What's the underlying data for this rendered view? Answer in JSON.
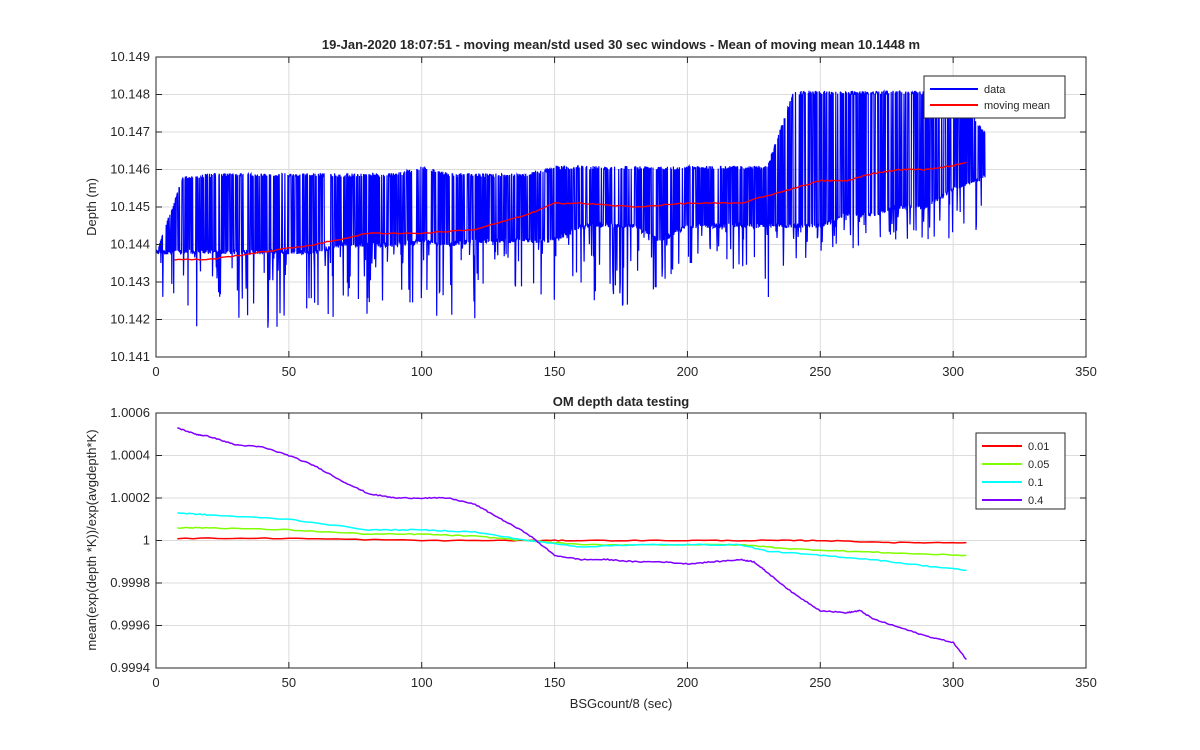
{
  "chart_data": [
    {
      "type": "line",
      "title": "19-Jan-2020 18:07:51 - moving mean/std used 30 sec windows - Mean of moving mean 10.1448 m",
      "xlabel": "",
      "ylabel": "Depth (m)",
      "xlim": [
        0,
        350
      ],
      "ylim": [
        10.141,
        10.149
      ],
      "xticks": [
        "0",
        "50",
        "100",
        "150",
        "200",
        "250",
        "300",
        "350"
      ],
      "yticks": [
        "10.141",
        "10.142",
        "10.143",
        "10.144",
        "10.145",
        "10.146",
        "10.147",
        "10.148",
        "10.149"
      ],
      "grid": true,
      "legend_position": "top-right",
      "series": [
        {
          "name": "data",
          "color": "#0000ff",
          "x": [
            0,
            10,
            20,
            30,
            40,
            50,
            60,
            70,
            80,
            90,
            100,
            110,
            120,
            130,
            140,
            150,
            160,
            170,
            180,
            190,
            200,
            210,
            220,
            230,
            240,
            250,
            260,
            270,
            280,
            290,
            300,
            312
          ],
          "low": [
            10.1415,
            10.1417,
            10.1418,
            10.1418,
            10.1418,
            10.1416,
            10.1418,
            10.1419,
            10.142,
            10.142,
            10.1422,
            10.142,
            10.1418,
            10.142,
            10.143,
            10.1421,
            10.1428,
            10.1422,
            10.1418,
            10.143,
            10.1435,
            10.1435,
            10.1432,
            10.1421,
            10.1435,
            10.1437,
            10.1438,
            10.1441,
            10.1441,
            10.1441,
            10.1441,
            10.1441
          ],
          "high": [
            10.1438,
            10.1458,
            10.1459,
            10.1459,
            10.1459,
            10.1459,
            10.1459,
            10.1459,
            10.1459,
            10.1459,
            10.1461,
            10.1459,
            10.1459,
            10.1459,
            10.1459,
            10.1461,
            10.1461,
            10.1461,
            10.1461,
            10.1461,
            10.1461,
            10.1461,
            10.1461,
            10.1461,
            10.1481,
            10.1481,
            10.1481,
            10.1481,
            10.1481,
            10.1481,
            10.1481,
            10.147
          ],
          "base": [
            10.1438,
            10.1438,
            10.1438,
            10.1438,
            10.1438,
            10.1438,
            10.1438,
            10.144,
            10.144,
            10.144,
            10.1441,
            10.144,
            10.1441,
            10.1441,
            10.1441,
            10.1441,
            10.1445,
            10.1445,
            10.1445,
            10.1441,
            10.1445,
            10.1445,
            10.1445,
            10.1445,
            10.1445,
            10.1445,
            10.1448,
            10.1448,
            10.145,
            10.145,
            10.1455,
            10.1458
          ]
        },
        {
          "name": "moving mean",
          "color": "#ff0000",
          "x": [
            7,
            20,
            40,
            60,
            80,
            100,
            120,
            140,
            150,
            160,
            180,
            200,
            220,
            240,
            250,
            260,
            270,
            280,
            290,
            300,
            305
          ],
          "y": [
            10.1436,
            10.1436,
            10.1438,
            10.144,
            10.1443,
            10.1443,
            10.1444,
            10.1448,
            10.1451,
            10.1451,
            10.145,
            10.1451,
            10.1451,
            10.1455,
            10.1457,
            10.1457,
            10.1459,
            10.146,
            10.146,
            10.1461,
            10.1462
          ]
        }
      ]
    },
    {
      "type": "line",
      "title": "OM depth data testing",
      "xlabel": "BSGcount/8 (sec)",
      "ylabel": "mean(exp(depth *K))/exp(avgdepth*K)",
      "xlim": [
        0,
        350
      ],
      "ylim": [
        0.9994,
        1.0006
      ],
      "xticks": [
        "0",
        "50",
        "100",
        "150",
        "200",
        "250",
        "300",
        "350"
      ],
      "yticks": [
        "0.9994",
        "0.9996",
        "0.9998",
        "1",
        "1.0002",
        "1.0004",
        "1.0006"
      ],
      "grid": true,
      "legend_position": "top-right",
      "series": [
        {
          "name": "0.01",
          "color": "#ff0000",
          "x": [
            8,
            50,
            100,
            140,
            160,
            200,
            230,
            250,
            280,
            305
          ],
          "y": [
            1.00001,
            1.00001,
            1.0,
            1.0,
            1.0,
            1.0,
            1.0,
            1.0,
            0.99999,
            0.99999
          ]
        },
        {
          "name": "0.05",
          "color": "#80ff00",
          "x": [
            8,
            20,
            50,
            80,
            100,
            120,
            140,
            160,
            190,
            220,
            240,
            260,
            280,
            305
          ],
          "y": [
            1.00006,
            1.00006,
            1.00005,
            1.00003,
            1.00003,
            1.00002,
            1.0,
            0.99998,
            0.99998,
            0.99998,
            0.99996,
            0.99995,
            0.99994,
            0.99993
          ]
        },
        {
          "name": "0.1",
          "color": "#00ffff",
          "x": [
            8,
            20,
            50,
            80,
            100,
            120,
            140,
            160,
            180,
            200,
            220,
            230,
            250,
            270,
            290,
            305
          ],
          "y": [
            1.00013,
            1.00012,
            1.0001,
            1.00005,
            1.00005,
            1.00004,
            1.0,
            0.99997,
            0.99998,
            0.99998,
            0.99998,
            0.99995,
            0.99993,
            0.99991,
            0.99988,
            0.99986
          ]
        },
        {
          "name": "0.4",
          "color": "#8000ff",
          "x": [
            8,
            15,
            20,
            30,
            40,
            50,
            60,
            70,
            80,
            90,
            100,
            110,
            120,
            130,
            140,
            150,
            160,
            170,
            180,
            190,
            200,
            210,
            220,
            225,
            230,
            240,
            250,
            260,
            265,
            270,
            280,
            290,
            300,
            305
          ],
          "y": [
            1.00053,
            1.0005,
            1.00049,
            1.00045,
            1.00044,
            1.0004,
            1.00035,
            1.00028,
            1.00022,
            1.0002,
            1.0002,
            1.0002,
            1.00017,
            1.0001,
            1.00003,
            0.99993,
            0.99991,
            0.99991,
            0.9999,
            0.9999,
            0.99989,
            0.9999,
            0.99991,
            0.9999,
            0.99985,
            0.99975,
            0.99967,
            0.99966,
            0.99967,
            0.99963,
            0.99959,
            0.99955,
            0.99952,
            0.99944
          ]
        }
      ]
    }
  ]
}
